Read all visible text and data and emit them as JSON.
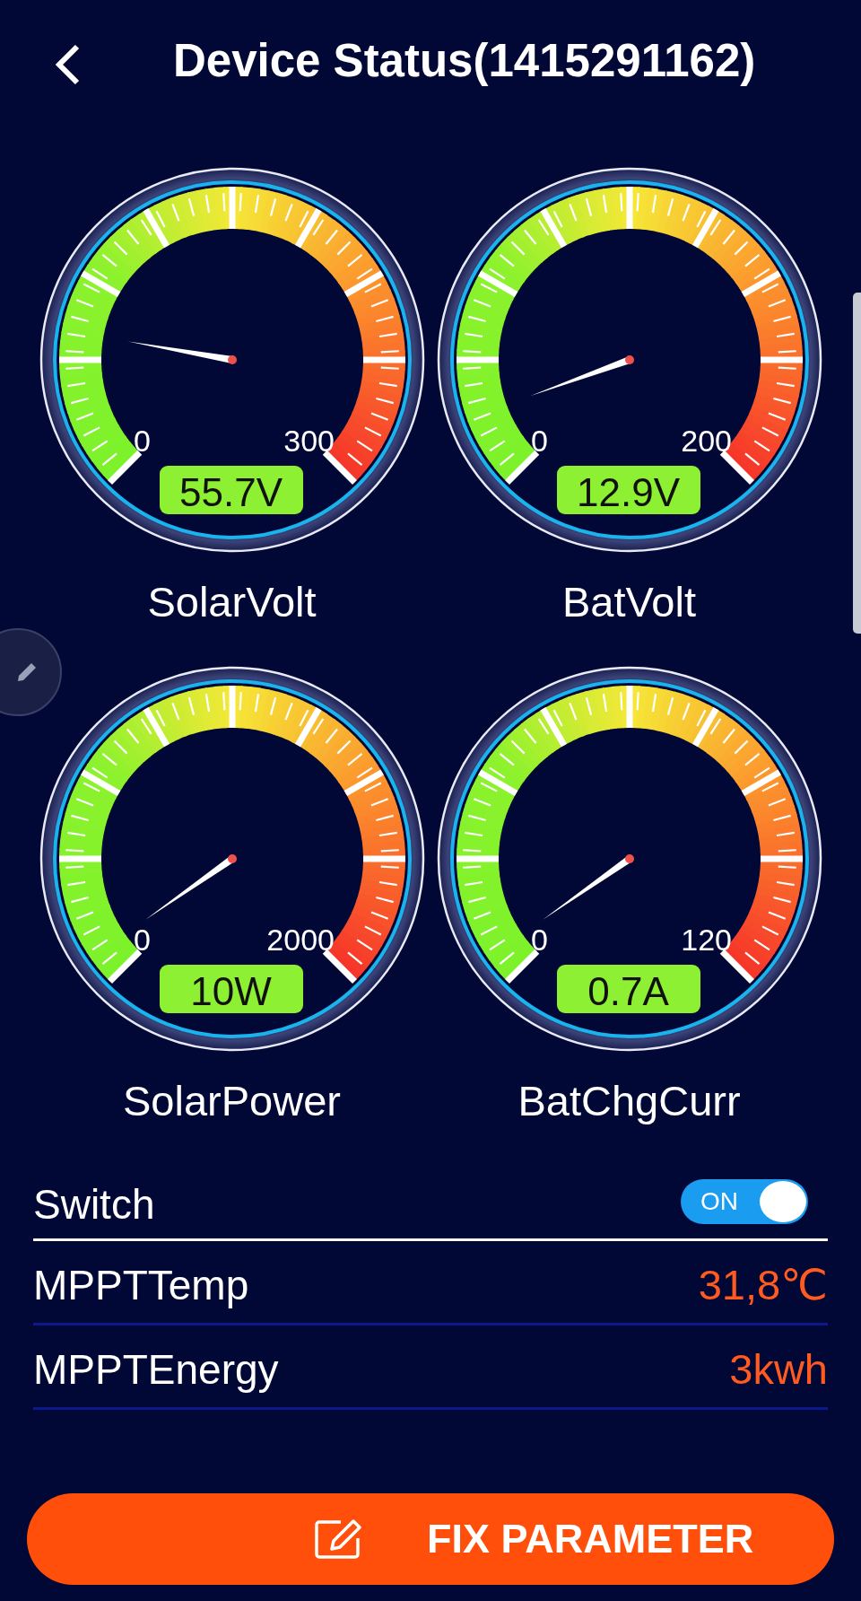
{
  "header": {
    "title": "Device Status(1415291162)"
  },
  "gauges": [
    {
      "label": "SolarVolt",
      "min": "0",
      "max": "300",
      "reading": "55.7V"
    },
    {
      "label": "BatVolt",
      "min": "0",
      "max": "200",
      "reading": "12.9V"
    },
    {
      "label": "SolarPower",
      "min": "0",
      "max": "2000",
      "reading": "10W"
    },
    {
      "label": "BatChgCurr",
      "min": "0",
      "max": "120",
      "reading": "0.7A"
    }
  ],
  "rows": [
    {
      "kind": "switch",
      "label": "Switch",
      "text": "ON",
      "on": true
    },
    {
      "kind": "value",
      "label": "MPPTTemp",
      "value": "31,8℃"
    },
    {
      "kind": "value",
      "label": "MPPTEnergy",
      "value": "3kwh"
    }
  ],
  "button": {
    "label": "FIX PARAMETER"
  }
}
